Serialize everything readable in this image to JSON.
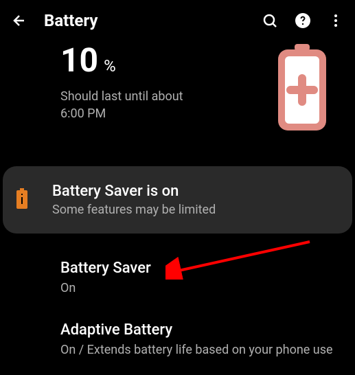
{
  "header": {
    "title": "Battery"
  },
  "battery": {
    "percent": "10",
    "percent_unit": "%",
    "estimate_line1": "Should last until about",
    "estimate_line2": "6:00 PM"
  },
  "saver_banner": {
    "title": "Battery Saver is on",
    "subtitle": "Some features may be limited"
  },
  "settings": {
    "battery_saver": {
      "title": "Battery Saver",
      "status": "On"
    },
    "adaptive_battery": {
      "title": "Adaptive Battery",
      "status": "On / Extends battery life based on your phone use"
    }
  },
  "colors": {
    "battery_icon": "#e08b82",
    "saver_icon": "#e67e22",
    "arrow": "#ff0000"
  }
}
